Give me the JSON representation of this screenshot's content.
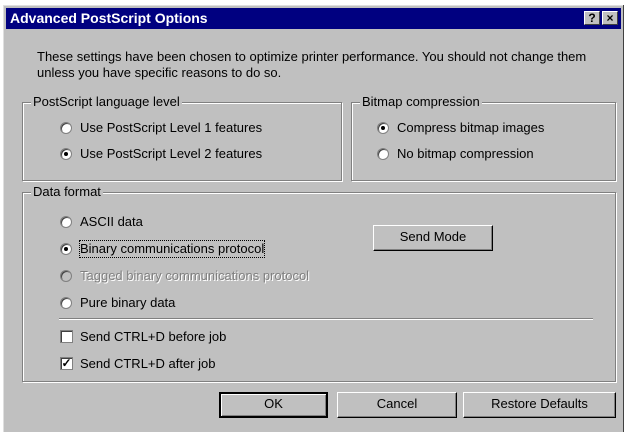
{
  "titlebar": {
    "title": "Advanced PostScript Options",
    "help": "?",
    "close": "×"
  },
  "intro": "These settings have been chosen to optimize printer performance. You should not change them unless you have specific reasons to do so.",
  "language_level": {
    "legend": "PostScript language level",
    "options": [
      {
        "label": "Use PostScript Level 1 features",
        "checked": false
      },
      {
        "label": "Use PostScript Level 2 features",
        "checked": true
      }
    ]
  },
  "bitmap": {
    "legend": "Bitmap compression",
    "options": [
      {
        "label": "Compress bitmap images",
        "checked": true
      },
      {
        "label": "No bitmap compression",
        "checked": false
      }
    ]
  },
  "data_format": {
    "legend": "Data format",
    "options": [
      {
        "label": "ASCII data",
        "checked": false
      },
      {
        "label": "Binary communications protocol",
        "checked": true
      },
      {
        "label": "Tagged binary communications protocol",
        "checked": false,
        "disabled": true
      },
      {
        "label": "Pure binary data",
        "checked": false
      }
    ],
    "send_mode": "Send Mode",
    "checkboxes": [
      {
        "label": "Send CTRL+D before job",
        "checked": false
      },
      {
        "label": "Send CTRL+D after job",
        "checked": true
      }
    ]
  },
  "buttons": {
    "ok": "OK",
    "cancel": "Cancel",
    "restore": "Restore Defaults"
  }
}
